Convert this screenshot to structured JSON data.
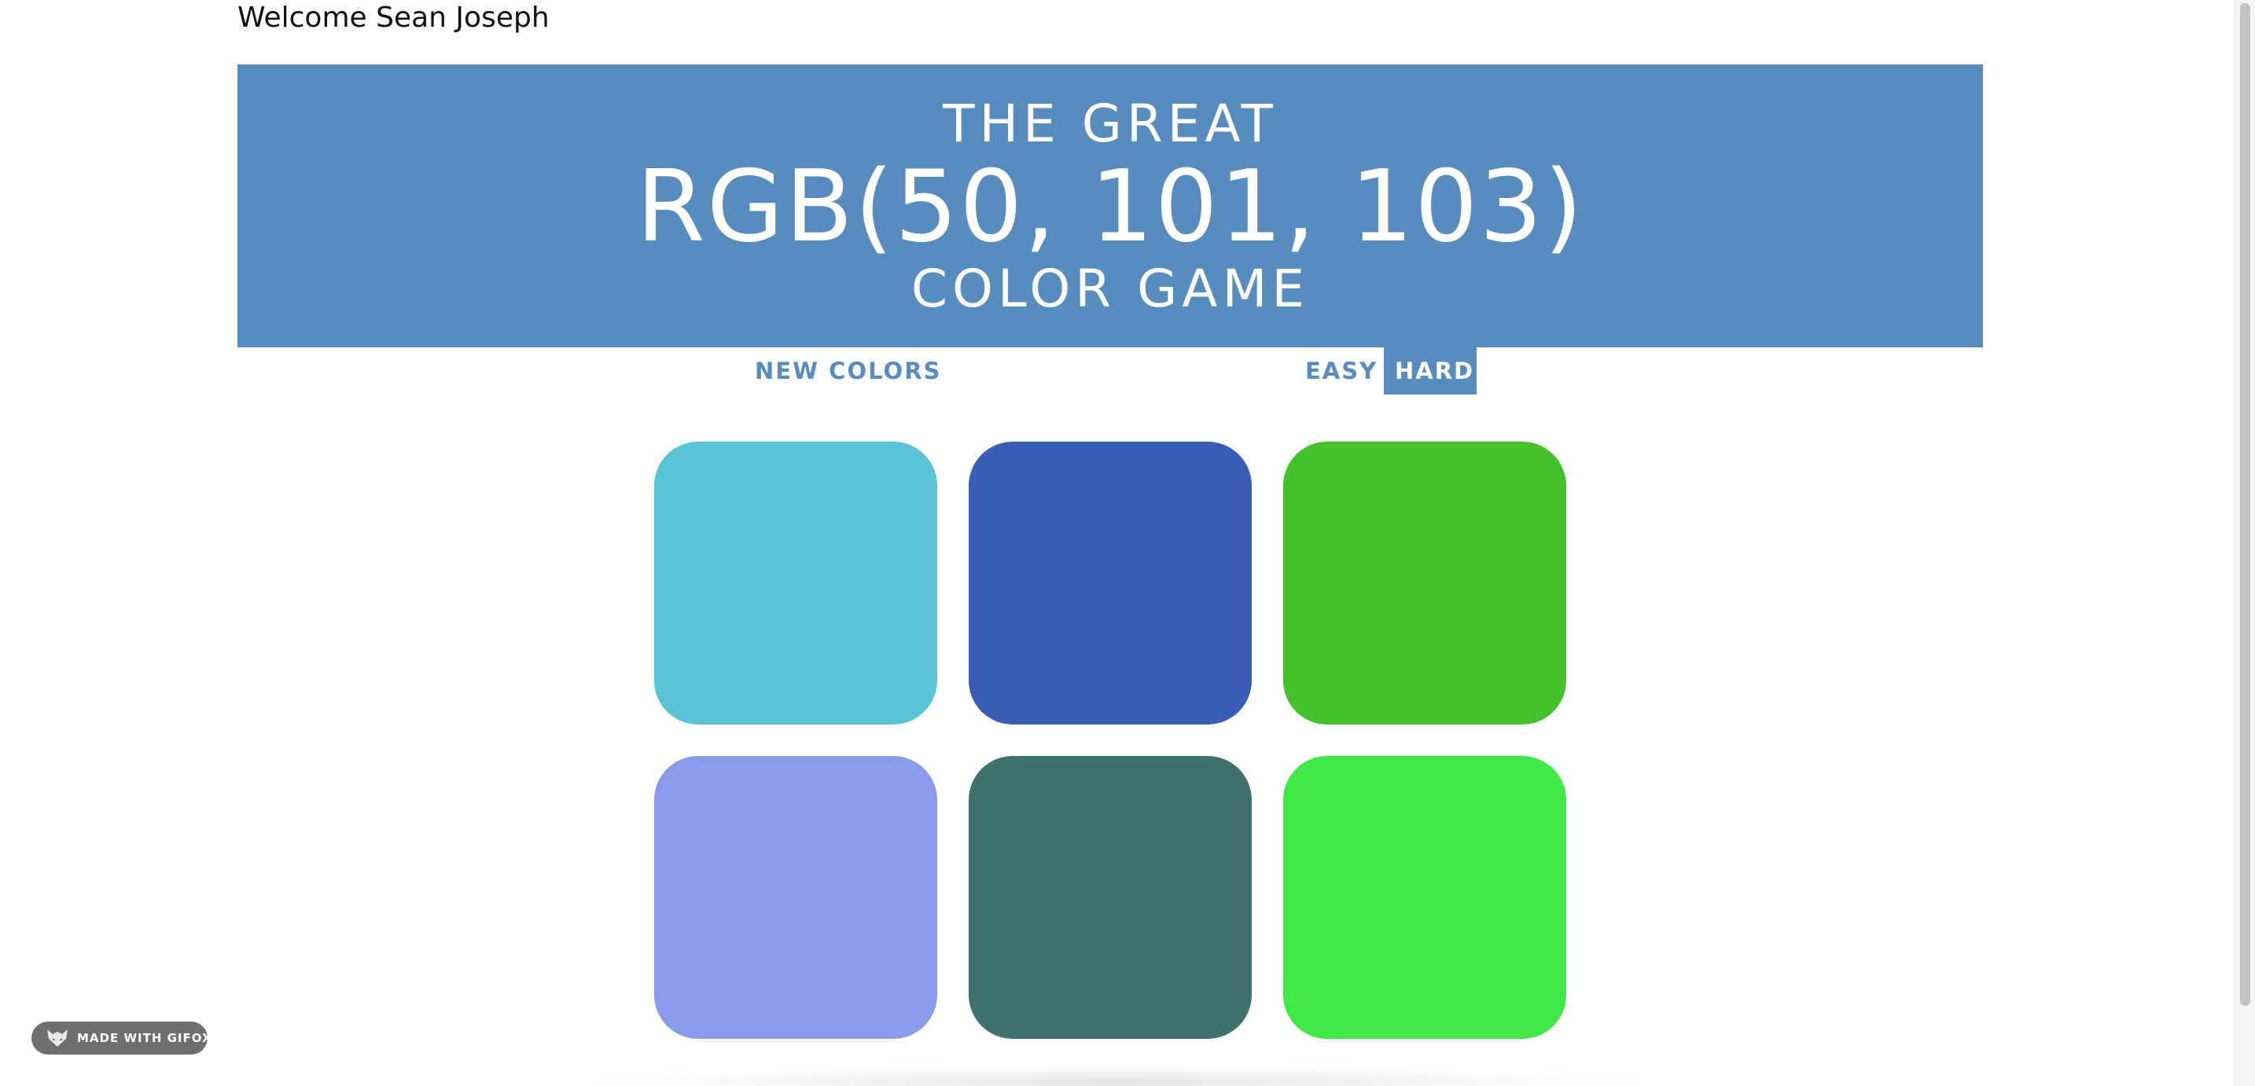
{
  "welcome": "Welcome Sean Joseph",
  "header": {
    "line1": "THE GREAT",
    "target_color": "RGB(50, 101, 103)",
    "line3": "COLOR GAME",
    "background_color": "#568cbe"
  },
  "controls": {
    "new_colors": "NEW COLORS",
    "easy": "EASY",
    "hard": "HARD",
    "selected_mode": "HARD"
  },
  "squares": [
    {
      "color": "#58c4d5"
    },
    {
      "color": "#3a5db6"
    },
    {
      "color": "#43c22b"
    },
    {
      "color": "#8a9aeb"
    },
    {
      "color": "#407171"
    },
    {
      "color": "#40e847"
    }
  ],
  "watermark": {
    "label": "MADE WITH GIFOX",
    "icon": "fox-icon"
  }
}
